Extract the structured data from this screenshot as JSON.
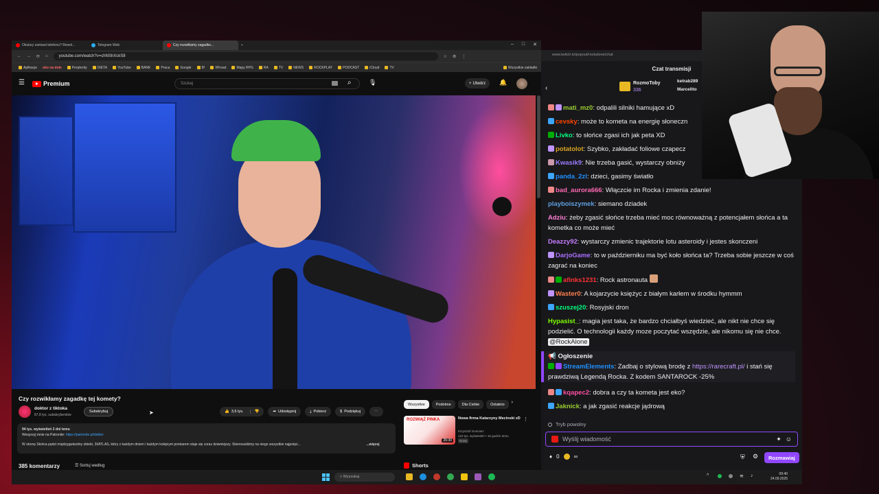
{
  "browser": {
    "tabs": [
      {
        "label": "Okulary zamiast telefonu? Rewol...",
        "color": "#ff0000"
      },
      {
        "label": "Telegram Web",
        "color": "#2aabee"
      },
      {
        "label": "Czy rozwiklamy zagadke...",
        "color": "#ff0000"
      }
    ],
    "url": "youtube.com/watch?v=chNShXckS8",
    "bookmarks": [
      "Aplikacje",
      "oko na dole",
      "Perplexity",
      "DIETA",
      "YouTube",
      "BANK",
      "Praca",
      "Google",
      "B!",
      "W!read",
      "Mapy RPG",
      "RA",
      "TV",
      "NEWS",
      "ROCKPLAY",
      "PODCAST",
      "iCloud",
      "TV"
    ],
    "bookmarks_right": "Wszystkie zakładki"
  },
  "youtube": {
    "logo": "Premium",
    "search_placeholder": "Szukaj",
    "create_label": "Utwórz",
    "video_title": "Czy rozwikłamy zagadkę tej komety?",
    "channel": "doktor z tiktoka",
    "subs": "87,8 tys. subskrybentów",
    "subscribe": "Subskrybuj",
    "likes": "3,6 tys.",
    "share": "Udostępnij",
    "download": "Pobierz",
    "thanks": "Podziękuj",
    "more": "⋯",
    "desc_stats": "94 tys. wyświetleń  2 dni temu",
    "desc_line2": "Wesprzyj mnie na Patronite: ",
    "desc_link": "https://patronite.pl/doktor",
    "desc_line3": "W stronę Słońca pędzi międzygwiezdny obiekt, 3I/ATLAS, który z każdym dniem i każdym kolejnym pomiarem staje się coraz dziwniejszy. Skierowaliśmy na niego wszystkie najpotęż...",
    "desc_more": "...więcej",
    "comments": "385 komentarzy",
    "sort": "Sortuj według",
    "chips": [
      "Wszystkie",
      "Podobne",
      "Dla Ciebie",
      "Ostatnio"
    ],
    "rec_thumb_text": "ROZWIĄŻ PINKA",
    "rec_duration": "26:30",
    "rec_title": "Nowa firma Katarzyny Mecinski xD",
    "rec_channel": "Krzysztof Gonciarz",
    "rec_meta": "123 tys. wyświetleń • 16 godzin temu",
    "rec_badge": "Nowy",
    "shorts": "Shorts"
  },
  "twitch": {
    "url": "www.twitch.tv/popout/rockalone/chat",
    "title": "Czat transmisji",
    "gifter": "RozmoToby",
    "gift_count": "336",
    "gifter2": "ketrab289",
    "gifter3": "Marcelito",
    "messages": [
      {
        "nick": "mati_mz0",
        "color": "#9acd32",
        "text": "odpalili silniki hamujące xD"
      },
      {
        "nick": "cevsky",
        "color": "#ff4500",
        "text": "może to kometa na energię słoneczn"
      },
      {
        "nick": "Livko",
        "color": "#00ff7f",
        "text": "to słońce zgasi ich jak peta XD"
      },
      {
        "nick": "potatolot",
        "color": "#daa520",
        "text": "Szybko, zakładać foliowe czapecz"
      },
      {
        "nick": "Kwasik9",
        "color": "#9a7cff",
        "text": "Nie trzeba gasić, wystarczy obniży"
      },
      {
        "nick": "panda_2zl",
        "color": "#1e90ff",
        "text": "dzieci, gasimy światło"
      },
      {
        "nick": "bad_aurora666",
        "color": "#ff69b4",
        "text": "Włączcie im Rocka i zmienia zdanie!"
      },
      {
        "nick": "playboiszymek",
        "color": "#5f9ee0",
        "text": "siemano dziadek"
      },
      {
        "nick": "Adziu",
        "color": "#ff7fd4",
        "text": "żeby zgasić słońce trzeba mieć moc równoważną z potencjałem słońca a ta kometka co może mieć"
      },
      {
        "nick": "Deazzy92",
        "color": "#c77dff",
        "text": "wystarczy zmienic trajektorie lotu asteroidy i jestes skonczeni"
      },
      {
        "nick": "DarjoGame",
        "color": "#a970ff",
        "text": "to w październiku ma być koło słońca ta? Trzeba sobie jeszcze w coś zagrać na koniec"
      },
      {
        "nick": "afinks1231",
        "color": "#ff3333",
        "text": "Rock astronauta"
      },
      {
        "nick": "Waster0",
        "color": "#ff7f50",
        "text": "A kojarzycie księżyc z białym karłem w środku hymmm"
      },
      {
        "nick": "szuszej20",
        "color": "#00ff7f",
        "text": "Rosyjski dron"
      },
      {
        "nick": "Hypasist_",
        "color": "#7fff00",
        "text": "magia jest taka, że bardzo chciałbyś wiedzieć, ale nikt nie chce się podzielić. O technologii każdy moze poczytać wszędzie, ale nikomu się nie chce.",
        "mention": "@RockAlone"
      }
    ],
    "announcement": {
      "header": "📢 Ogłoszenie",
      "nick": "StreamElements",
      "nick_color": "#1e90ff",
      "text1": "Zadbaj o stylową brodę z ",
      "link": "https://rarecraft.pl/",
      "text2": " i stań się prawdziwą Legendą Rocka. Z kodem SANTAROCK -25%"
    },
    "messages2": [
      {
        "nick": "kqapec2",
        "color": "#ff4fa3",
        "text": "dobra a czy ta kometa jest eko?"
      },
      {
        "nick": "Jaknick",
        "color": "#9acd32",
        "text": "a jak zgasić reakcje jądrową"
      }
    ],
    "mode": "Tryb powolny",
    "input_placeholder": "Wyślij wiadomość",
    "points": "0",
    "infinity": "∞",
    "send": "Rozmawiaj"
  },
  "taskbar": {
    "search": "Wyszukaj",
    "time": "09:40",
    "date": "24.09.2025"
  }
}
